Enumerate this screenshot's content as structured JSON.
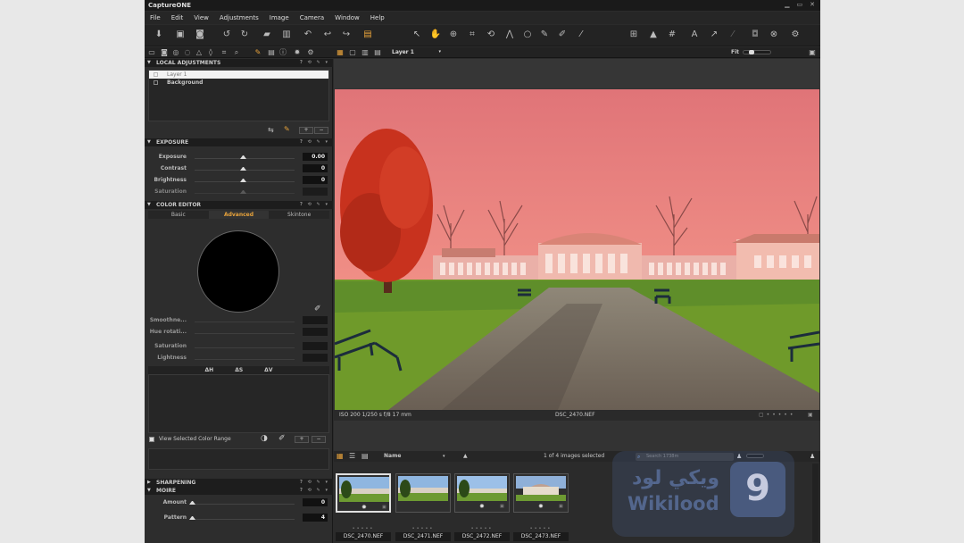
{
  "app": {
    "title": "CaptureONE"
  },
  "menu": [
    "File",
    "Edit",
    "View",
    "Adjustments",
    "Image",
    "Camera",
    "Window",
    "Help"
  ],
  "toolbar_row2": {
    "layer_select": "Layer 1",
    "fit": "Fit"
  },
  "local_adjustments": {
    "header": "LOCAL ADJUSTMENTS",
    "layers": [
      {
        "name": "Layer 1",
        "selected": true
      },
      {
        "name": "Background",
        "selected": false
      }
    ]
  },
  "exposure": {
    "header": "EXPOSURE",
    "rows": [
      {
        "label": "Exposure",
        "value": "0.00",
        "knob": 0.5
      },
      {
        "label": "Contrast",
        "value": "0",
        "knob": 0.5
      },
      {
        "label": "Brightness",
        "value": "0",
        "knob": 0.5
      },
      {
        "label": "Saturation",
        "value": "",
        "knob": 0.5
      }
    ]
  },
  "color_editor": {
    "header": "COLOR EDITOR",
    "tabs": [
      "Basic",
      "Advanced",
      "Skintone"
    ],
    "active_tab": "Advanced",
    "rows": [
      {
        "label": "Smoothne...",
        "value": ""
      },
      {
        "label": "Hue rotati...",
        "value": ""
      },
      {
        "label": "Saturation",
        "value": ""
      },
      {
        "label": "Lightness",
        "value": ""
      }
    ],
    "delta_headers": [
      "ΔH",
      "ΔS",
      "ΔV"
    ],
    "view_selected_label": "View Selected Color Range"
  },
  "sharpening": {
    "header": "SHARPENING"
  },
  "moire": {
    "header": "MOIRE",
    "rows": [
      {
        "label": "Amount",
        "value": "0",
        "knob": 0.0
      },
      {
        "label": "Pattern",
        "value": "4",
        "knob": 0.0
      }
    ]
  },
  "viewer": {
    "info": "ISO 200  1/250 s  f/8  17 mm",
    "filename": "DSC_2470.NEF"
  },
  "browser": {
    "sort": "Name",
    "count": "1 of 4 images selected",
    "search_placeholder": "Search 1738m",
    "thumbs": [
      {
        "name": "DSC_2470.NEF",
        "selected": true
      },
      {
        "name": "DSC_2471.NEF",
        "selected": false
      },
      {
        "name": "DSC_2472.NEF",
        "selected": false
      },
      {
        "name": "DSC_2473.NEF",
        "selected": false
      }
    ]
  },
  "watermark": {
    "arabic": "ويكي لود",
    "english": "Wikilood",
    "logo": "9"
  },
  "colors": {
    "accent": "#e8a33b",
    "sky_mask": "#e07878",
    "tree_mask": "#c8321e",
    "grass": "#6f9a2a"
  }
}
